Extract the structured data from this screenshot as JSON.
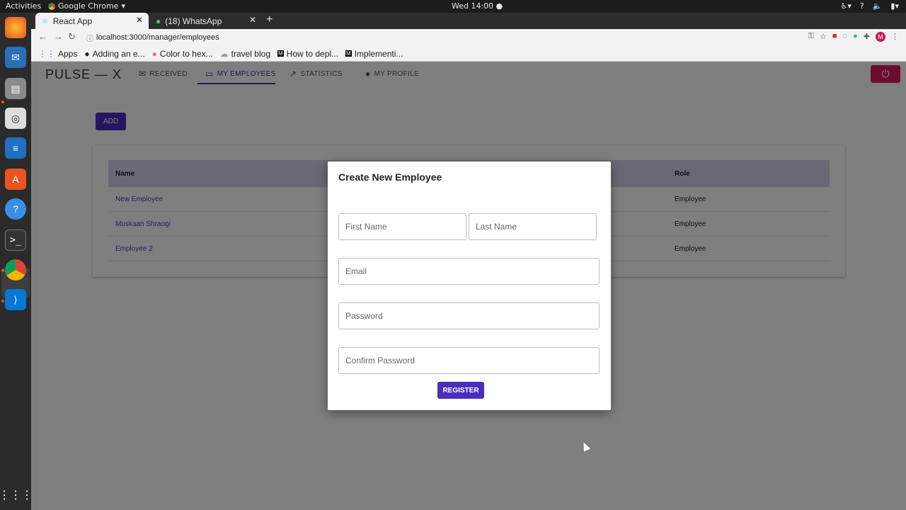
{
  "os": {
    "activities": "Activities",
    "app_name": "Google Chrome",
    "clock": "Wed 14:00"
  },
  "browser": {
    "tabs": [
      {
        "label": "React App"
      },
      {
        "label": "(18) WhatsApp"
      }
    ],
    "url": "localhost:3000/manager/employees",
    "bookmarks": [
      {
        "label": "Apps"
      },
      {
        "label": "Adding an e..."
      },
      {
        "label": "Color to hex..."
      },
      {
        "label": "travel blog"
      },
      {
        "label": "How to depl..."
      },
      {
        "label": "Implementi..."
      }
    ],
    "profile_initial": "M"
  },
  "app": {
    "brand": "PULSE — X",
    "nav": [
      {
        "label": "RECEIVED"
      },
      {
        "label": "MY EMPLOYEES"
      },
      {
        "label": "STATISTICS"
      },
      {
        "label": "MY PROFILE"
      }
    ],
    "add_label": "ADD",
    "table": {
      "headers": [
        "Name",
        "Role"
      ],
      "rows": [
        {
          "name": "New Employee",
          "role": "Employee"
        },
        {
          "name": "Muskaan Shraogi",
          "role": "Employee"
        },
        {
          "name": "Employee 2",
          "role": "Employee"
        }
      ]
    }
  },
  "modal": {
    "title": "Create New Employee",
    "first_name_placeholder": "First Name",
    "last_name_placeholder": "Last Name",
    "email_placeholder": "Email",
    "password_placeholder": "Password",
    "confirm_password_placeholder": "Confirm Password",
    "register_label": "REGISTER"
  },
  "colors": {
    "primary": "#4a2fbd",
    "danger": "#d81b60",
    "table_header": "#d6d0ea"
  }
}
